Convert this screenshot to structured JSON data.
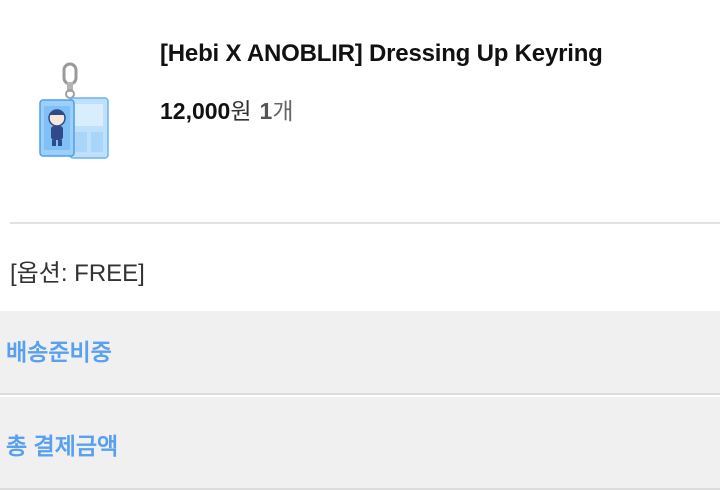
{
  "product": {
    "title": "[Hebi X ANOBLIR] Dressing Up Keyring",
    "price": "12,000",
    "currency": "원",
    "quantity": "1",
    "quantity_unit": "개",
    "thumbnail_icon": "acrylic-keyring-image"
  },
  "option": {
    "text": "[옵션: FREE]"
  },
  "status": {
    "label": "배송준비중"
  },
  "total": {
    "label": "총 결제금액"
  },
  "colors": {
    "accent": "#5aa0f0",
    "panel_bg": "#f0f0f0",
    "divider": "#e2e2e2"
  }
}
